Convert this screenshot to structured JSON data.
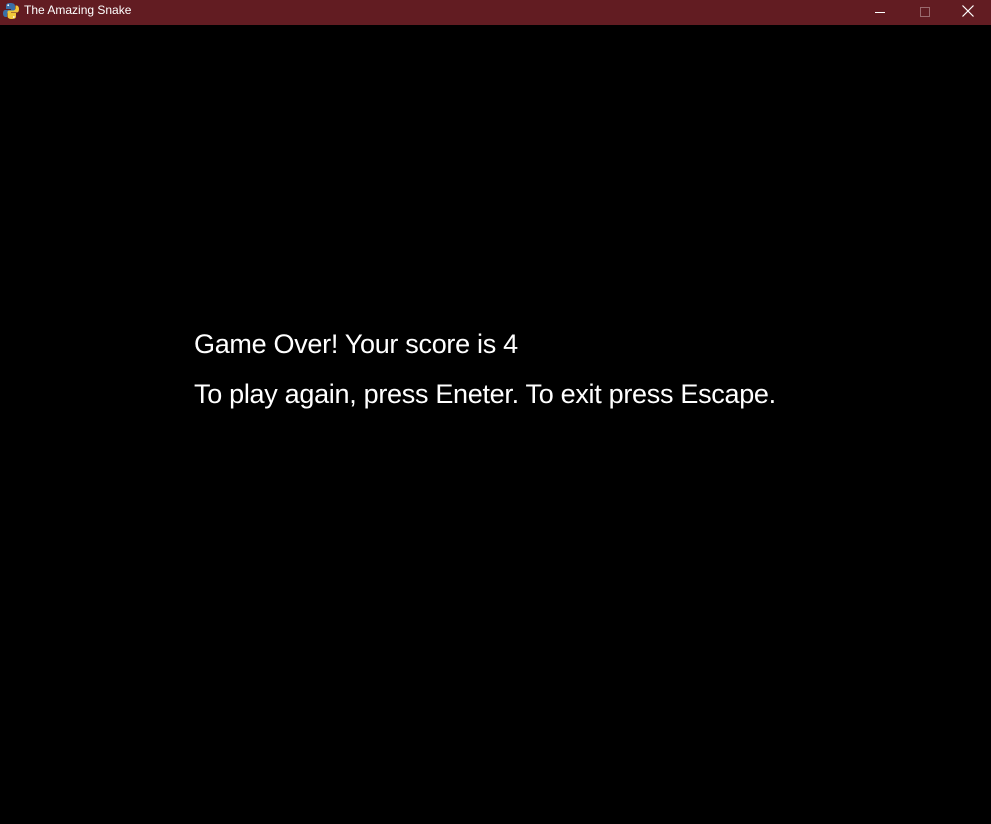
{
  "window": {
    "title": "The Amazing Snake",
    "titlebar_color": "#621c22",
    "icon": "python-snake-icon",
    "controls": [
      "minimize-icon",
      "maximize-icon",
      "close-icon"
    ]
  },
  "game": {
    "background_color": "#000000",
    "text_color": "#ffffff",
    "game_over_message": "Game Over! Your score is 4",
    "instructions": "To play again, press Eneter. To exit press Escape."
  }
}
